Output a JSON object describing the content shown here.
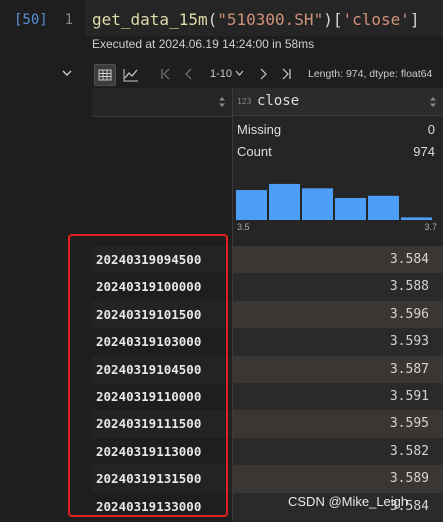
{
  "cell": {
    "exec_count": "[50]",
    "line_number": "1",
    "code": {
      "fn": "get_data_15m",
      "open": "(",
      "arg": "\"510300.SH\"",
      "close_idx": ")[",
      "key": "'close'",
      "end": "]"
    },
    "status": "Executed at 2024.06.19 14:24:00 in 58ms"
  },
  "toolbar": {
    "range": "1-10",
    "length_info": "Length: 974, dtype: float64",
    "icons": [
      "table-icon",
      "chart-icon",
      "first-page-icon",
      "prev-page-icon",
      "next-page-icon",
      "last-page-icon"
    ]
  },
  "column": {
    "type_icon": "123",
    "name": "close",
    "stats": {
      "missing_label": "Missing",
      "missing_value": "0",
      "count_label": "Count",
      "count_value": "974"
    },
    "histogram": {
      "min_label": "3.5",
      "max_label": "3.7",
      "bins": [
        0.68,
        0.82,
        0.72,
        0.5,
        0.55,
        0.06
      ]
    }
  },
  "rows": [
    {
      "index": "20240319094500",
      "value": "3.584"
    },
    {
      "index": "20240319100000",
      "value": "3.588"
    },
    {
      "index": "20240319101500",
      "value": "3.596"
    },
    {
      "index": "20240319103000",
      "value": "3.593"
    },
    {
      "index": "20240319104500",
      "value": "3.587"
    },
    {
      "index": "20240319110000",
      "value": "3.591"
    },
    {
      "index": "20240319111500",
      "value": "3.595"
    },
    {
      "index": "20240319113000",
      "value": "3.582"
    },
    {
      "index": "20240319131500",
      "value": "3.589"
    },
    {
      "index": "20240319133000",
      "value": "3.584"
    }
  ],
  "watermark": "CSDN @Mike_Leigh",
  "colors": {
    "accent": "#5c8fd6",
    "histogram": "#4d9ef6",
    "highlight_box": "#e02020"
  }
}
